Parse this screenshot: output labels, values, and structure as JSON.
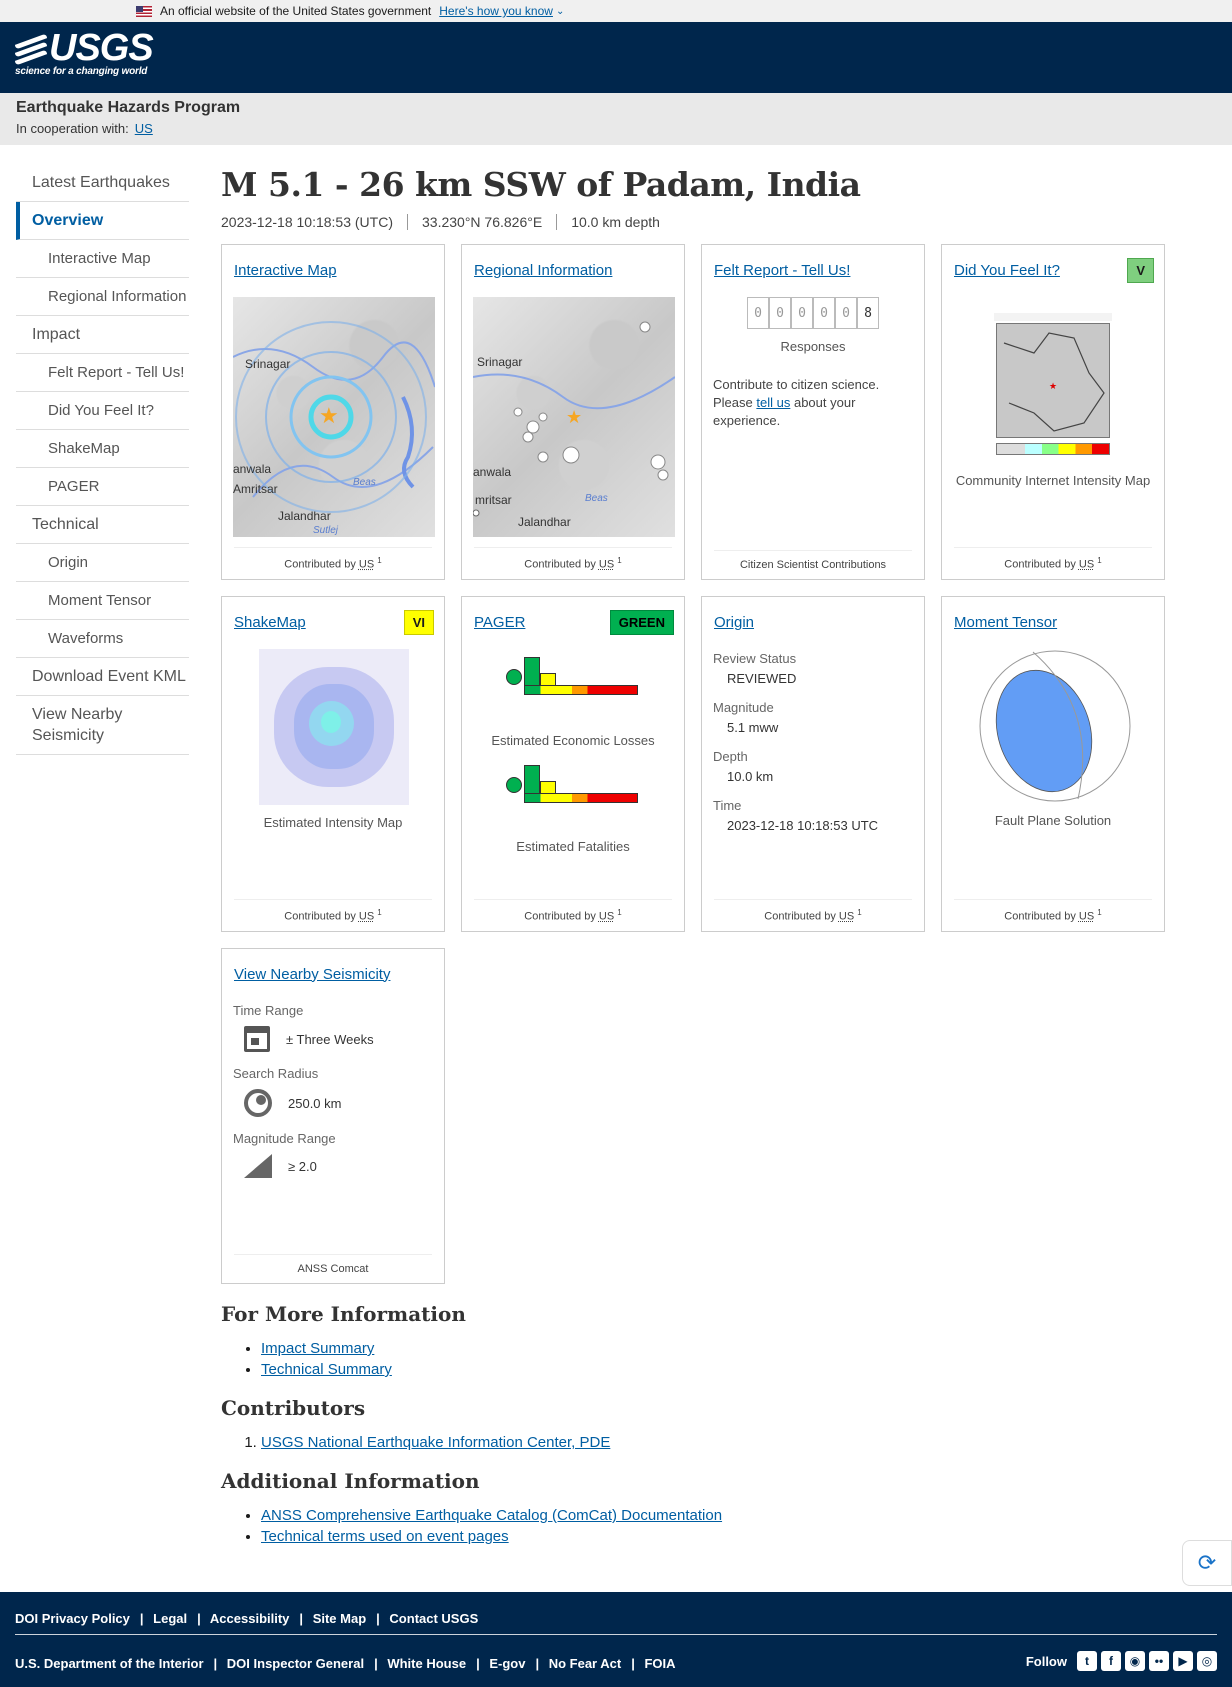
{
  "gov_banner": {
    "text": "An official website of the United States government",
    "link": "Here's how you know"
  },
  "header": {
    "logo_text": "USGS",
    "tagline": "science for a changing world"
  },
  "program": {
    "title": "Earthquake Hazards Program",
    "coop_label": "In cooperation with:",
    "coop_link": "US"
  },
  "sidebar": [
    {
      "label": "Latest Earthquakes",
      "level": 1
    },
    {
      "label": "Overview",
      "level": 1,
      "active": true
    },
    {
      "label": "Interactive Map",
      "level": 2
    },
    {
      "label": "Regional Information",
      "level": 2
    },
    {
      "label": "Impact",
      "level": 1
    },
    {
      "label": "Felt Report - Tell Us!",
      "level": 2
    },
    {
      "label": "Did You Feel It?",
      "level": 2
    },
    {
      "label": "ShakeMap",
      "level": 2
    },
    {
      "label": "PAGER",
      "level": 2
    },
    {
      "label": "Technical",
      "level": 1
    },
    {
      "label": "Origin",
      "level": 2
    },
    {
      "label": "Moment Tensor",
      "level": 2
    },
    {
      "label": "Waveforms",
      "level": 2
    },
    {
      "label": "Download Event KML",
      "level": 1
    },
    {
      "label": "View Nearby Seismicity",
      "level": 1
    }
  ],
  "event": {
    "title": "M 5.1 - 26 km SSW of Padam, India",
    "time": "2023-12-18 10:18:53 (UTC)",
    "location": "33.230°N 76.826°E",
    "depth": "10.0 km depth"
  },
  "cards": {
    "contributed_by": "Contributed by",
    "contributor_abbr": "US",
    "contributor_sup": "1",
    "interactive_map": {
      "title": "Interactive Map",
      "labels": [
        "Srinagar",
        "anwala",
        "Amritsar",
        "Jalandhar",
        "Beas",
        "Sutlej"
      ]
    },
    "regional": {
      "title": "Regional Information",
      "labels": [
        "Srinagar",
        "anwala",
        "mritsar",
        "Jalandhar",
        "Beas"
      ]
    },
    "felt": {
      "title": "Felt Report - Tell Us!",
      "digits": [
        "0",
        "0",
        "0",
        "0",
        "0",
        "8"
      ],
      "responses": "Responses",
      "text_before": "Contribute to citizen science. Please",
      "link": "tell us",
      "text_after": "about your experience.",
      "footer": "Citizen Scientist Contributions"
    },
    "dyfi": {
      "title": "Did You Feel It?",
      "badge": "V",
      "badge_color": "#7fcf7f",
      "caption": "Community Internet Intensity Map"
    },
    "shakemap": {
      "title": "ShakeMap",
      "badge": "VI",
      "badge_color": "#ffff00",
      "caption": "Estimated Intensity Map"
    },
    "pager": {
      "title": "PAGER",
      "badge": "GREEN",
      "badge_color": "#00b050",
      "caption_losses": "Estimated Economic Losses",
      "caption_fatalities": "Estimated Fatalities"
    },
    "origin": {
      "title": "Origin",
      "fields": [
        {
          "label": "Review Status",
          "value": "REVIEWED"
        },
        {
          "label": "Magnitude",
          "value": "5.1 mww"
        },
        {
          "label": "Depth",
          "value": "10.0 km"
        },
        {
          "label": "Time",
          "value": "2023-12-18 10:18:53 UTC"
        }
      ]
    },
    "moment_tensor": {
      "title": "Moment Tensor",
      "caption": "Fault Plane Solution"
    },
    "nearby": {
      "title": "View Nearby Seismicity",
      "time_label": "Time Range",
      "time_value": "± Three Weeks",
      "radius_label": "Search Radius",
      "radius_value": "250.0 km",
      "mag_label": "Magnitude Range",
      "mag_value": "≥ 2.0",
      "footer": "ANSS Comcat"
    }
  },
  "more_info": {
    "title": "For More Information",
    "links": [
      "Impact Summary",
      "Technical Summary"
    ]
  },
  "contributors": {
    "title": "Contributors",
    "items": [
      "USGS National Earthquake Information Center, PDE"
    ]
  },
  "additional": {
    "title": "Additional Information",
    "links": [
      "ANSS Comprehensive Earthquake Catalog (ComCat) Documentation",
      "Technical terms used on event pages"
    ]
  },
  "footer": {
    "row1": [
      "DOI Privacy Policy",
      "Legal",
      "Accessibility",
      "Site Map",
      "Contact USGS"
    ],
    "row2": [
      "U.S. Department of the Interior",
      "DOI Inspector General",
      "White House",
      "E-gov",
      "No Fear Act",
      "FOIA"
    ],
    "follow": "Follow"
  }
}
